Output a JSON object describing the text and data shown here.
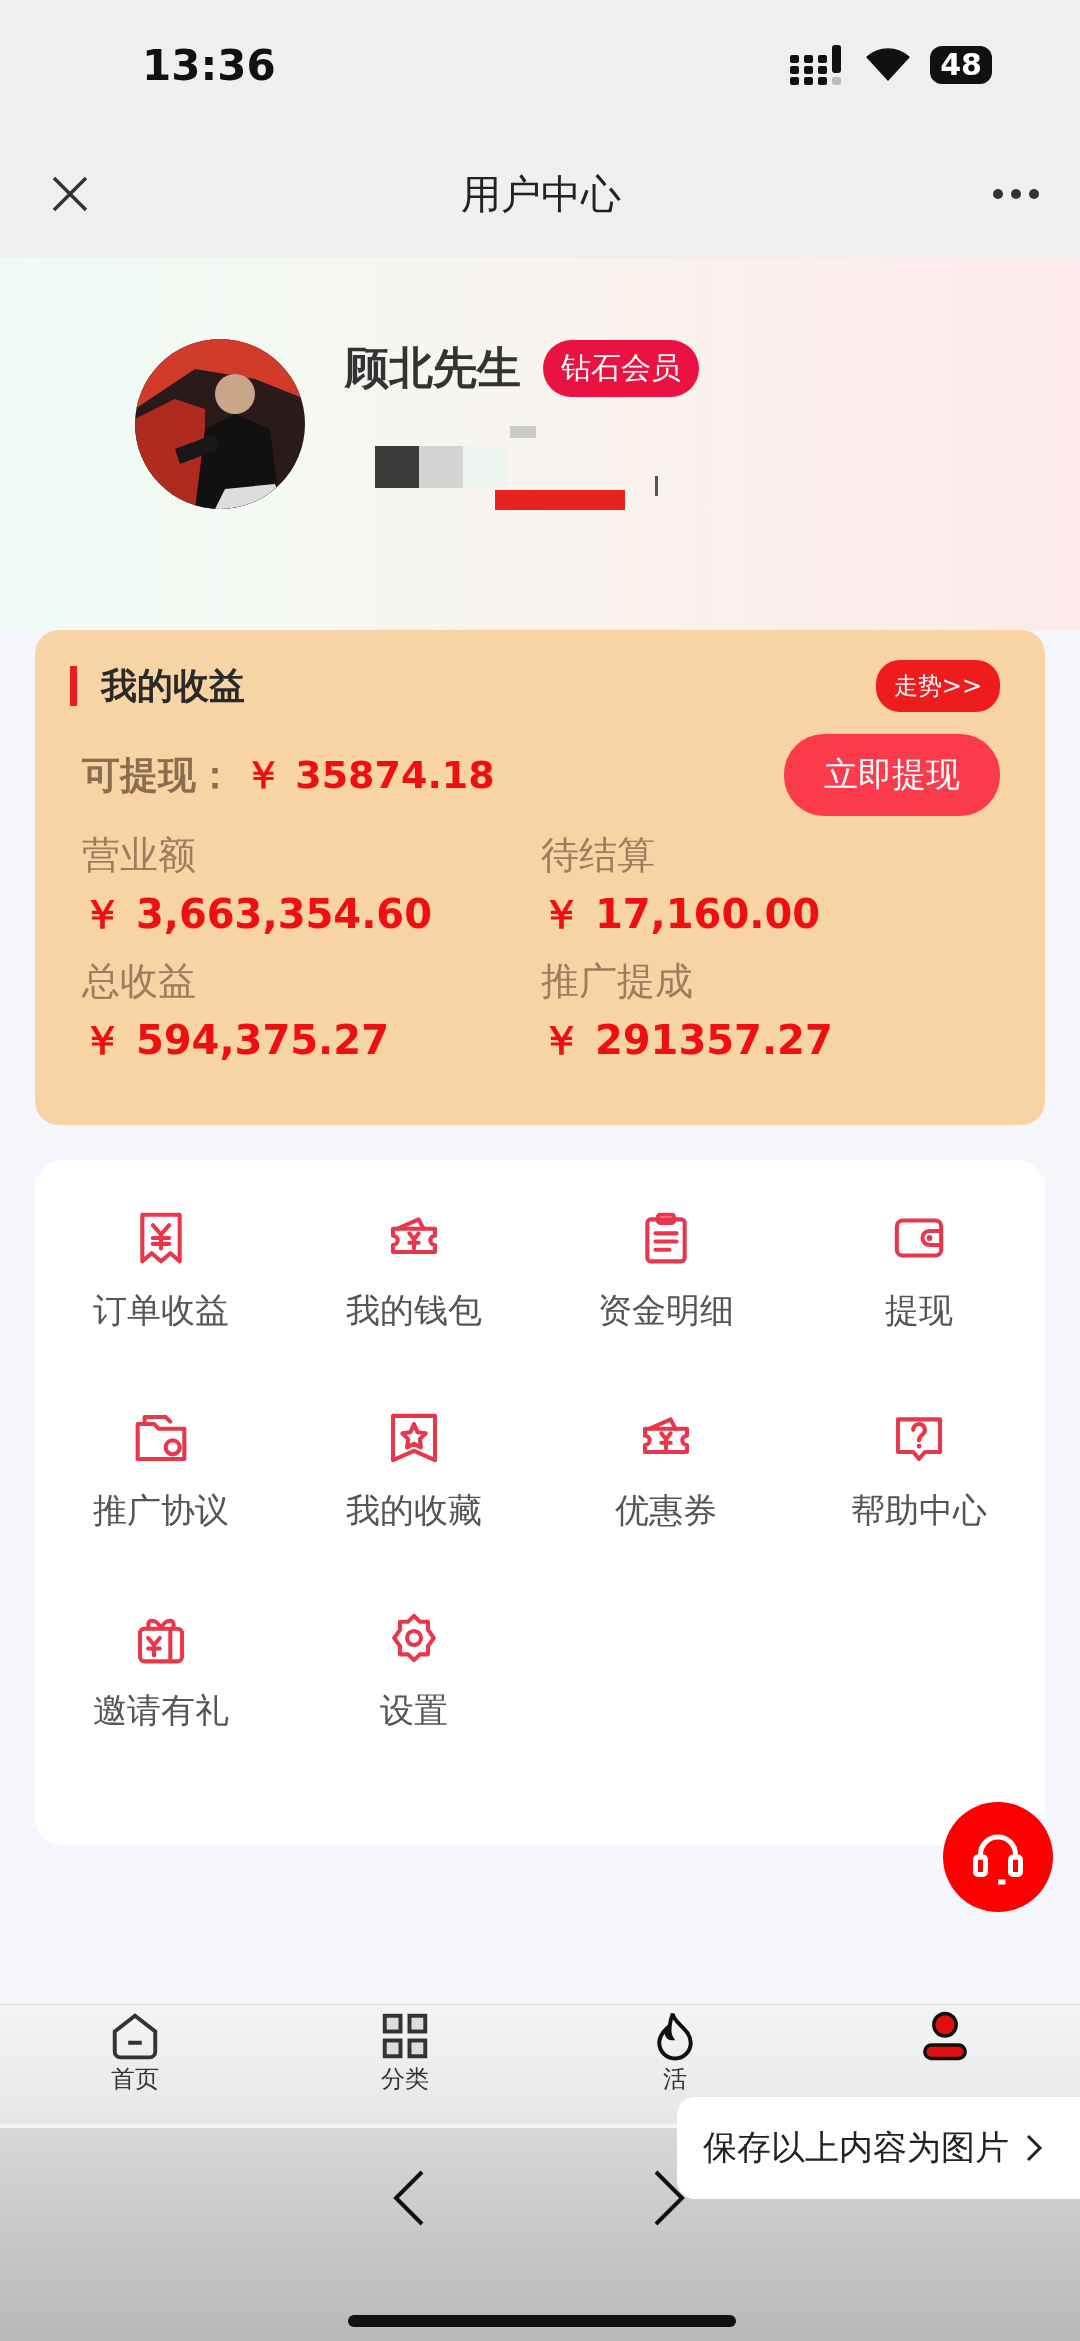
{
  "status_bar": {
    "time": "13:36",
    "battery": "48"
  },
  "nav_bar": {
    "title": "用户中心"
  },
  "profile": {
    "name": "顾北先生",
    "badge": "钻石会员"
  },
  "earnings": {
    "title": "我的收益",
    "trend_button": "走势>>",
    "withdrawable_label": "可提现：",
    "withdrawable_value": "￥ 35874.18",
    "withdraw_button": "立即提现",
    "stats": [
      {
        "label": "营业额",
        "value": "￥ 3,663,354.60"
      },
      {
        "label": "待结算",
        "value": "￥ 17,160.00"
      },
      {
        "label": "总收益",
        "value": "￥ 594,375.27"
      },
      {
        "label": "推广提成",
        "value": "￥ 291357.27"
      }
    ]
  },
  "menu": [
    {
      "label": "订单收益"
    },
    {
      "label": "我的钱包"
    },
    {
      "label": "资金明细"
    },
    {
      "label": "提现"
    },
    {
      "label": "推广协议"
    },
    {
      "label": "我的收藏"
    },
    {
      "label": "优惠券"
    },
    {
      "label": "帮助中心"
    },
    {
      "label": "邀请有礼"
    },
    {
      "label": "设置"
    }
  ],
  "tab_bar": [
    {
      "label": "首页",
      "selected": false
    },
    {
      "label": "分类",
      "selected": false
    },
    {
      "label": "活",
      "selected": false
    },
    {
      "selected": true
    }
  ],
  "save_popup": {
    "label": "保存以上内容为图片"
  }
}
